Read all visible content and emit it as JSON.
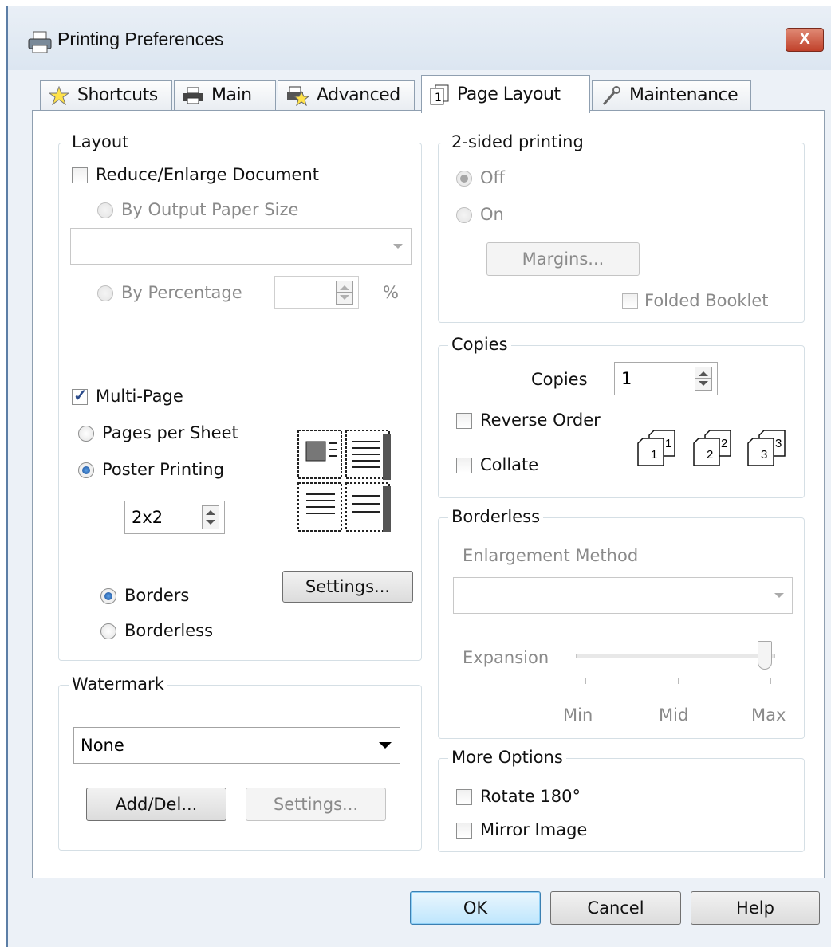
{
  "window": {
    "title": "Printing Preferences",
    "close_glyph": "X"
  },
  "tabs": [
    {
      "label": "Shortcuts",
      "icon": "star-icon"
    },
    {
      "label": "Main",
      "icon": "printer-icon"
    },
    {
      "label": "Advanced",
      "icon": "advanced-settings-icon"
    },
    {
      "label": "Page Layout",
      "icon": "page-layout-icon",
      "active": true
    },
    {
      "label": "Maintenance",
      "icon": "wrench-icon"
    }
  ],
  "layout": {
    "title": "Layout",
    "reduce_enlarge": {
      "label": "Reduce/Enlarge Document",
      "checked": false
    },
    "by_output_paper_size": "By Output Paper Size",
    "paper_size_value": "",
    "by_percentage": "By Percentage",
    "percentage_value": "",
    "percent_sign": "%",
    "multi_page": {
      "label": "Multi-Page",
      "checked": true
    },
    "pages_per_sheet": "Pages per Sheet",
    "poster_printing": {
      "label": "Poster Printing",
      "selected": true
    },
    "poster_value": "2x2",
    "borders": {
      "label": "Borders",
      "selected": true
    },
    "borderless": "Borderless",
    "settings_button": "Settings..."
  },
  "two_sided": {
    "title": "2-sided printing",
    "off": {
      "label": "Off",
      "selected": true
    },
    "on": "On",
    "margins_button": "Margins...",
    "folded_booklet": "Folded Booklet"
  },
  "copies": {
    "title": "Copies",
    "copies_label": "Copies",
    "copies_value": "1",
    "reverse_order": "Reverse Order",
    "collate": "Collate",
    "collate_sample_labels": [
      "1",
      "1",
      "2",
      "2",
      "3",
      "3"
    ]
  },
  "borderless": {
    "title": "Borderless",
    "enlargement_method": "Enlargement Method",
    "enlargement_value": "",
    "expansion": "Expansion",
    "expansion_level": "Max",
    "scale_min": "Min",
    "scale_mid": "Mid",
    "scale_max": "Max"
  },
  "watermark": {
    "title": "Watermark",
    "value": "None",
    "add_del_button": "Add/Del...",
    "settings_button": "Settings..."
  },
  "more_options": {
    "title": "More Options",
    "rotate_180": "Rotate 180°",
    "mirror_image": "Mirror Image"
  },
  "footer": {
    "ok": "OK",
    "cancel": "Cancel",
    "help": "Help"
  }
}
